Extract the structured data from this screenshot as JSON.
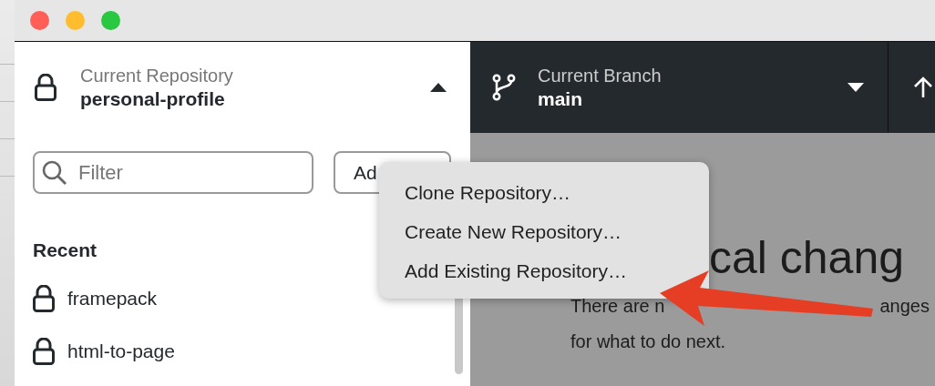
{
  "toolbar": {
    "repository": {
      "label": "Current Repository",
      "name": "personal-profile",
      "expanded": true
    },
    "branch": {
      "label": "Current Branch",
      "name": "main",
      "expanded": false
    }
  },
  "sidebar": {
    "filter": {
      "placeholder": "Filter"
    },
    "add_button": {
      "label": "Ad"
    },
    "section": "Recent",
    "repositories": [
      {
        "name": "framepack"
      },
      {
        "name": "html-to-page"
      }
    ]
  },
  "menu": {
    "items": [
      {
        "label": "Clone Repository…"
      },
      {
        "label": "Create New Repository…"
      },
      {
        "label": "Add Existing Repository…"
      }
    ]
  },
  "main": {
    "heading": "cal chang",
    "message": [
      {
        "parts": [
          "There are n",
          "anges"
        ]
      },
      {
        "parts": [
          "for what to do next."
        ]
      }
    ]
  }
}
